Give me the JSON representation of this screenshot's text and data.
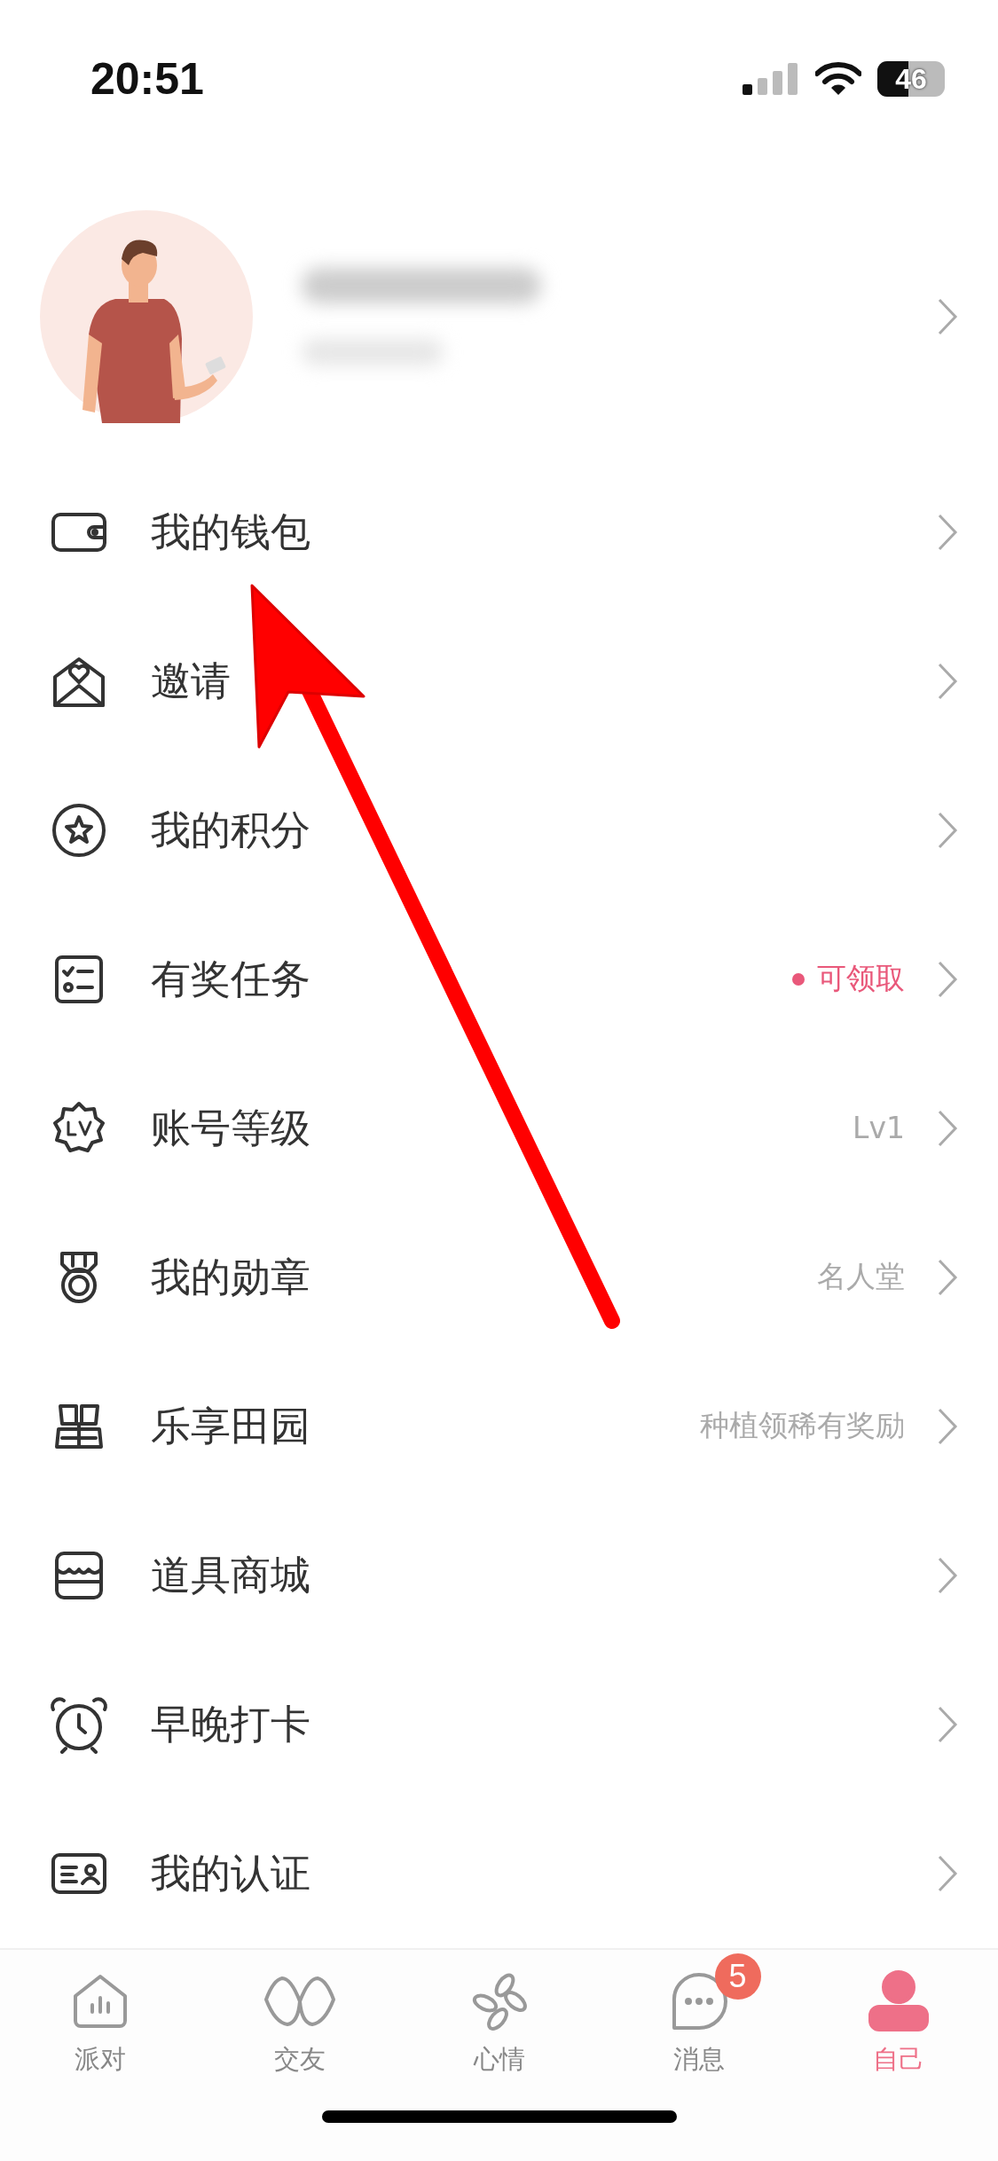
{
  "status_bar": {
    "time": "20:51",
    "battery": "46"
  },
  "menu": [
    {
      "label": "我的钱包"
    },
    {
      "label": "邀请"
    },
    {
      "label": "我的积分"
    },
    {
      "label": "有奖任务",
      "hint": "可领取",
      "highlighted": true
    },
    {
      "label": "账号等级",
      "hint": "Lv1",
      "highlighted": false
    },
    {
      "label": "我的勋章",
      "hint": "名人堂",
      "highlighted": false
    },
    {
      "label": "乐享田园",
      "hint": "种植领稀有奖励",
      "highlighted": false
    },
    {
      "label": "道具商城"
    },
    {
      "label": "早晚打卡"
    },
    {
      "label": "我的认证"
    }
  ],
  "tabs": [
    {
      "label": "派对",
      "selected": false
    },
    {
      "label": "交友",
      "selected": false
    },
    {
      "label": "心情",
      "selected": false
    },
    {
      "label": "消息",
      "selected": false,
      "badge": "5"
    },
    {
      "label": "自己",
      "selected": true
    }
  ]
}
